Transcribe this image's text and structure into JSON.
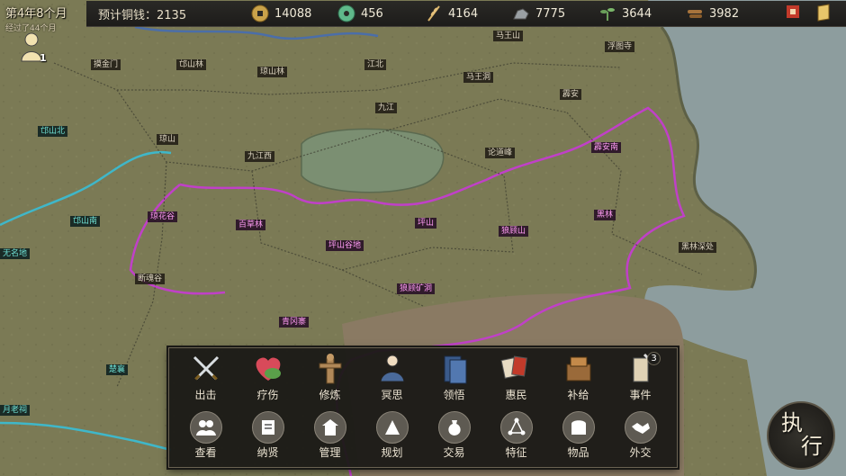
{
  "date": {
    "main": "第4年8个月",
    "elapsed": "经过了44个月"
  },
  "topbar": {
    "copper_label": "预计铜钱：",
    "copper_value": "2135",
    "resources": [
      {
        "name": "coin",
        "icon": "copper-coin-icon",
        "value": "14088"
      },
      {
        "name": "jade",
        "icon": "jade-icon",
        "value": "456"
      },
      {
        "name": "grain",
        "icon": "wheat-icon",
        "value": "4164"
      },
      {
        "name": "iron",
        "icon": "ore-icon",
        "value": "7775"
      },
      {
        "name": "herb",
        "icon": "herb-icon",
        "value": "3644"
      },
      {
        "name": "wood",
        "icon": "timber-icon",
        "value": "3982"
      }
    ]
  },
  "avatar": {
    "count": "1"
  },
  "map_labels": [
    {
      "text": "邙山林",
      "style": "own"
    },
    {
      "text": "琼山林",
      "style": "own"
    },
    {
      "text": "江北",
      "style": "own"
    },
    {
      "text": "马王山",
      "style": "own"
    },
    {
      "text": "浮图寺",
      "style": "own"
    },
    {
      "text": "摸金门",
      "style": "own"
    },
    {
      "text": "马王洞",
      "style": "own"
    },
    {
      "text": "霹安",
      "style": "own"
    },
    {
      "text": "九江",
      "style": "own"
    },
    {
      "text": "邙山北",
      "style": "ally"
    },
    {
      "text": "琼山",
      "style": "own"
    },
    {
      "text": "论道峰",
      "style": "own"
    },
    {
      "text": "霹安南",
      "style": "en"
    },
    {
      "text": "九江西",
      "style": "own"
    },
    {
      "text": "琼花谷",
      "style": "en"
    },
    {
      "text": "百草林",
      "style": "en"
    },
    {
      "text": "坪山",
      "style": "en"
    },
    {
      "text": "黑林",
      "style": "en"
    },
    {
      "text": "邙山南",
      "style": "ally"
    },
    {
      "text": "狼顾山",
      "style": "en"
    },
    {
      "text": "坪山谷地",
      "style": "en"
    },
    {
      "text": "黑林深处",
      "style": "own"
    },
    {
      "text": "无名地",
      "style": "ally"
    },
    {
      "text": "断魂谷",
      "style": "own"
    },
    {
      "text": "狼顾矿洞",
      "style": "en"
    },
    {
      "text": "青冈寨",
      "style": "en"
    },
    {
      "text": "楚襄",
      "style": "ally"
    },
    {
      "text": "月老祠",
      "style": "ally"
    }
  ],
  "actions_row1": [
    {
      "label": "出击",
      "icon": "crossed-swords-icon"
    },
    {
      "label": "疗伤",
      "icon": "heart-herb-icon"
    },
    {
      "label": "修炼",
      "icon": "training-dummy-icon"
    },
    {
      "label": "冥思",
      "icon": "meditating-monk-icon"
    },
    {
      "label": "领悟",
      "icon": "scroll-book-icon"
    },
    {
      "label": "惠民",
      "icon": "cards-icon"
    },
    {
      "label": "补给",
      "icon": "supply-bundle-icon"
    },
    {
      "label": "事件",
      "icon": "scroll-quill-icon",
      "badge": "3"
    }
  ],
  "actions_row2": [
    {
      "label": "查看",
      "icon": "people-icon"
    },
    {
      "label": "纳贤",
      "icon": "recruit-scroll-icon"
    },
    {
      "label": "管理",
      "icon": "pagoda-icon"
    },
    {
      "label": "规划",
      "icon": "build-icon"
    },
    {
      "label": "交易",
      "icon": "money-bag-icon"
    },
    {
      "label": "特征",
      "icon": "nodes-icon"
    },
    {
      "label": "物品",
      "icon": "chest-icon"
    },
    {
      "label": "外交",
      "icon": "handshake-icon"
    }
  ],
  "exec_button": {
    "char1": "执",
    "char2": "行"
  },
  "colors": {
    "enemy_border": "#c040c8",
    "ally_border": "#3fb7c9",
    "river": "#4b6ea8",
    "sea": "#8fa0a2"
  }
}
